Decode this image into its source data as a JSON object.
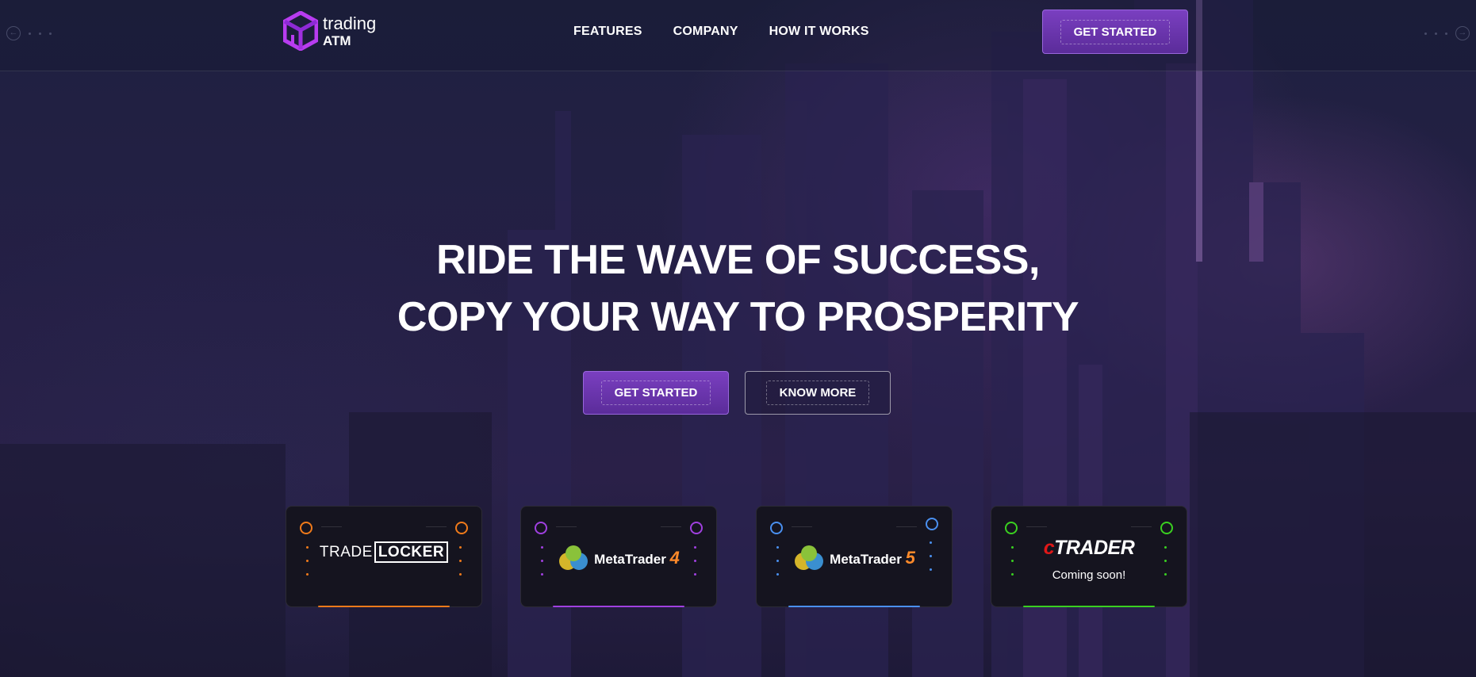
{
  "header": {
    "logo_line1": "trading",
    "logo_line2": "ATM",
    "nav": [
      "FEATURES",
      "COMPANY",
      "HOW IT WORKS"
    ],
    "cta_label": "GET STARTED"
  },
  "hero": {
    "title_line1": "RIDE THE WAVE OF SUCCESS,",
    "title_line2": "COPY YOUR WAY TO PROSPERITY",
    "primary_label": "GET STARTED",
    "secondary_label": "KNOW MORE"
  },
  "platforms": [
    {
      "name_prefix": "TRADE",
      "name_suffix": "LOCKER",
      "accent": "#f07a1a"
    },
    {
      "name": "MetaTrader",
      "version": "4",
      "accent": "#a040e0"
    },
    {
      "name": "MetaTrader",
      "version": "5",
      "accent": "#4a90f0"
    },
    {
      "name_prefix": "c",
      "name_suffix": "TRADER",
      "status": "Coming soon!",
      "accent": "#3ad020"
    }
  ],
  "colors": {
    "brand": "#b83cf0",
    "primary_button": "#6a35ae",
    "background": "#1d1d3a"
  }
}
